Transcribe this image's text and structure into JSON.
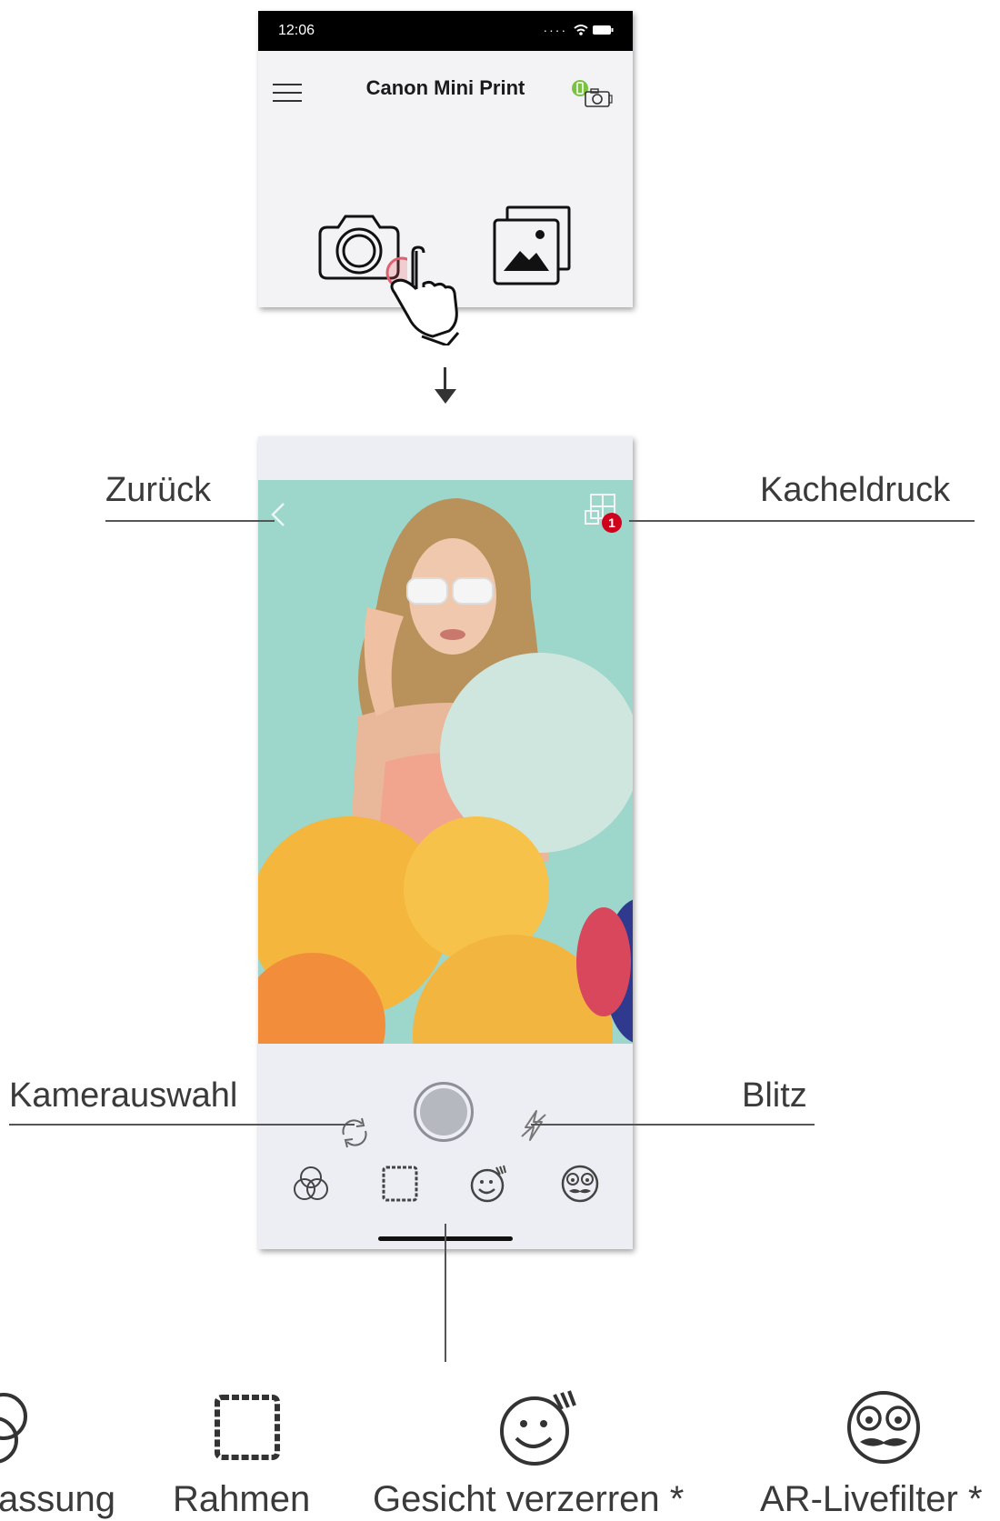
{
  "phone1": {
    "status_time": "12:06",
    "app_title": "Canon Mini Print"
  },
  "callouts": {
    "back": "Zurück",
    "tile_print": "Kacheldruck",
    "camera_select": "Kamerauswahl",
    "flash": "Blitz"
  },
  "tile_print_badge": "1",
  "bottom_tools": [
    {
      "label": "assung",
      "icon": "filter-icon"
    },
    {
      "label": "Rahmen",
      "icon": "frame-icon"
    },
    {
      "label": "Gesicht verzerren *",
      "icon": "face-warp-icon"
    },
    {
      "label": "AR-Livefilter *",
      "icon": "ar-face-icon"
    }
  ],
  "colors": {
    "photo_bg": "#9dd6cb",
    "badge": "#d0021b",
    "printer_status": "#7cc242"
  }
}
